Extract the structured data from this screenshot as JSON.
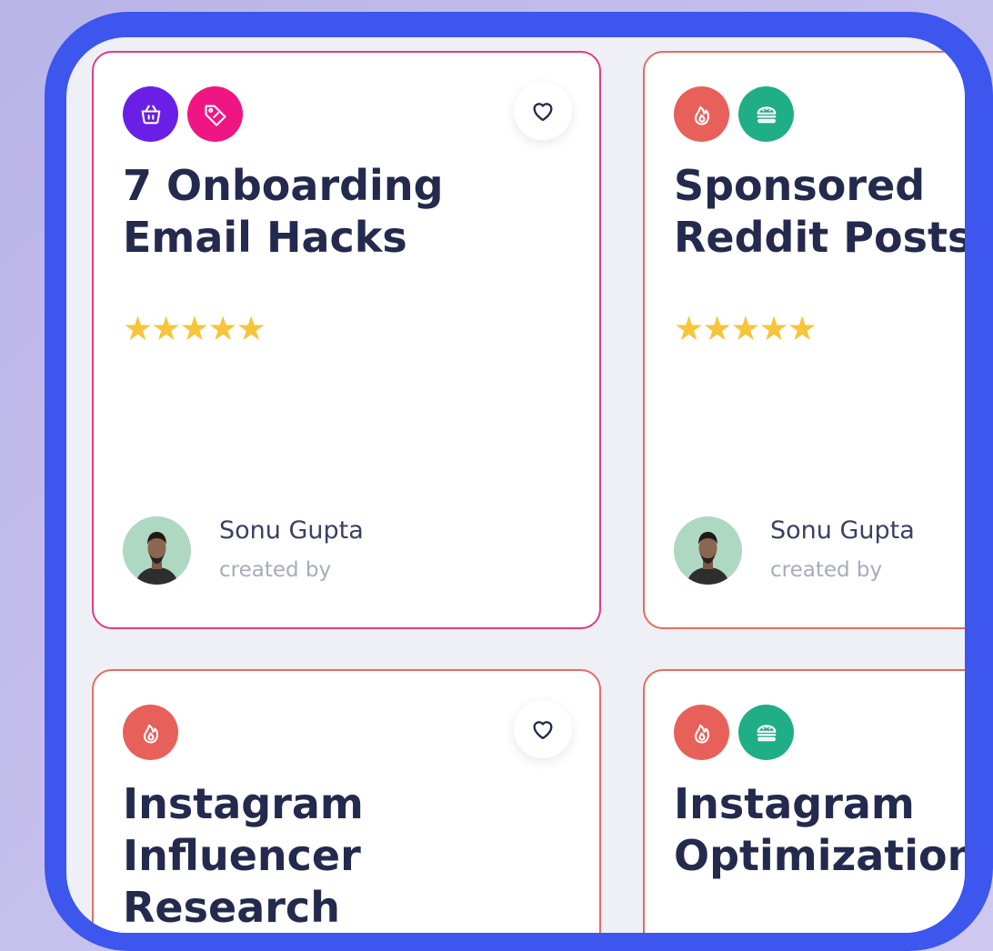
{
  "colors": {
    "device_frame": "#3c56ee",
    "screen_bg": "#eef0f6",
    "title_text": "#232a4e",
    "star": "#f7c43a",
    "card_border_pink": "#e23b84",
    "card_border_coral": "#ea6b5e"
  },
  "cards": [
    {
      "title": "7 Onboarding\nEmail Hacks",
      "rating": 5,
      "stars": "★★★★★",
      "tags": [
        {
          "icon": "basket-icon",
          "color": "#6a1fe6"
        },
        {
          "icon": "price-tag-icon",
          "color": "#ef1684"
        }
      ],
      "favorite_icon": "heart-icon",
      "author": {
        "name": "Sonu Gupta",
        "role": "created by"
      }
    },
    {
      "title": "Sponsored\nReddit Posts",
      "rating": 5,
      "stars": "★★★★★",
      "tags": [
        {
          "icon": "flame-icon",
          "color": "#e8605a"
        },
        {
          "icon": "burger-icon",
          "color": "#1fae86"
        }
      ],
      "author": {
        "name": "Sonu Gupta",
        "role": "created by"
      }
    },
    {
      "title": "Instagram\nInfluencer\nResearch",
      "tags": [
        {
          "icon": "flame-icon",
          "color": "#e8605a"
        }
      ],
      "favorite_icon": "heart-icon"
    },
    {
      "title": "Instagram\nOptimization",
      "tags": [
        {
          "icon": "flame-icon",
          "color": "#e8605a"
        },
        {
          "icon": "burger-icon",
          "color": "#1fae86"
        }
      ]
    }
  ]
}
